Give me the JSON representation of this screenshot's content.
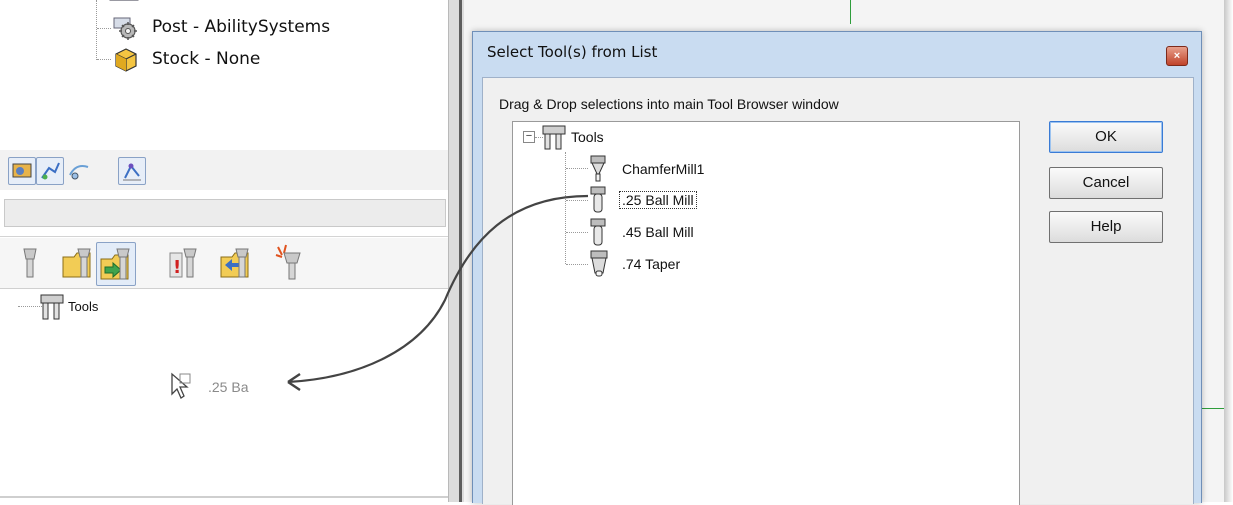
{
  "project_tree": {
    "items": [
      {
        "label": "Post - AbilitySystems",
        "icon": "gear-icon"
      },
      {
        "label": "Stock - None",
        "icon": "stock-box-icon"
      }
    ]
  },
  "left_tools_tree": {
    "root_label": "Tools"
  },
  "drag_ghost": {
    "label": ".25 Ba",
    "icon": "drag-cursor-icon"
  },
  "dialog": {
    "title": "Select Tool(s) from List",
    "close_label": "×",
    "instruction": "Drag & Drop selections into main Tool Browser window",
    "tree": {
      "expander": "−",
      "root_label": "Tools",
      "items": [
        {
          "label": "ChamferMill1",
          "icon": "chamfer-mill-icon"
        },
        {
          "label": ".25 Ball Mill",
          "icon": "ball-mill-icon",
          "selected": true
        },
        {
          "label": ".45 Ball Mill",
          "icon": "ball-mill-icon"
        },
        {
          "label": ".74 Taper",
          "icon": "taper-mill-icon"
        }
      ]
    },
    "buttons": {
      "ok": "OK",
      "cancel": "Cancel",
      "help": "Help"
    }
  },
  "colors": {
    "dialog_frame": "#c9dcf1",
    "grid_green": "#2e9d3b",
    "drag_arrow": "#444444"
  }
}
